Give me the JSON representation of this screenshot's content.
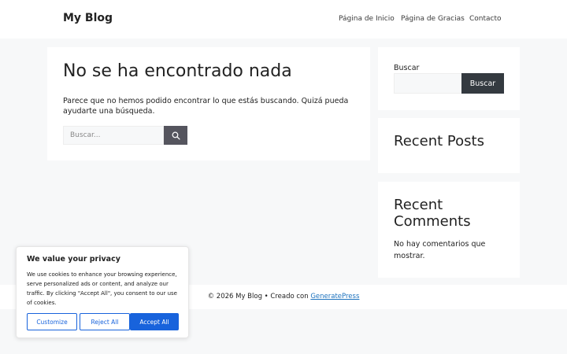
{
  "header": {
    "site_title": "My Blog",
    "nav": [
      "Página de Inicio",
      "Página de Gracias",
      "Contacto"
    ]
  },
  "main": {
    "title": "No se ha encontrado nada",
    "message": "Parece que no hemos podido encontrar lo que estás buscando. Quizá pueda ayudarte una búsqueda.",
    "search_placeholder": "Buscar...",
    "search_icon": "search-icon"
  },
  "sidebar": {
    "search_label": "Buscar",
    "search_button": "Buscar",
    "recent_posts_title": "Recent Posts",
    "recent_comments_title": "Recent Comments",
    "no_comments": "No hay comentarios que mostrar."
  },
  "footer": {
    "prefix": "© 2026 My Blog • Creado con ",
    "link": "GeneratePress"
  },
  "cookie": {
    "title": "We value your privacy",
    "text": "We use cookies to enhance your browsing experience, serve personalized ads or content, and analyze our traffic. By clicking \"Accept All\", you consent to our use of cookies.",
    "customize": "Customize",
    "reject": "Reject All",
    "accept": "Accept All"
  },
  "colors": {
    "accent": "#1863dc",
    "dark_button": "#343a40",
    "link": "#1e73be"
  }
}
